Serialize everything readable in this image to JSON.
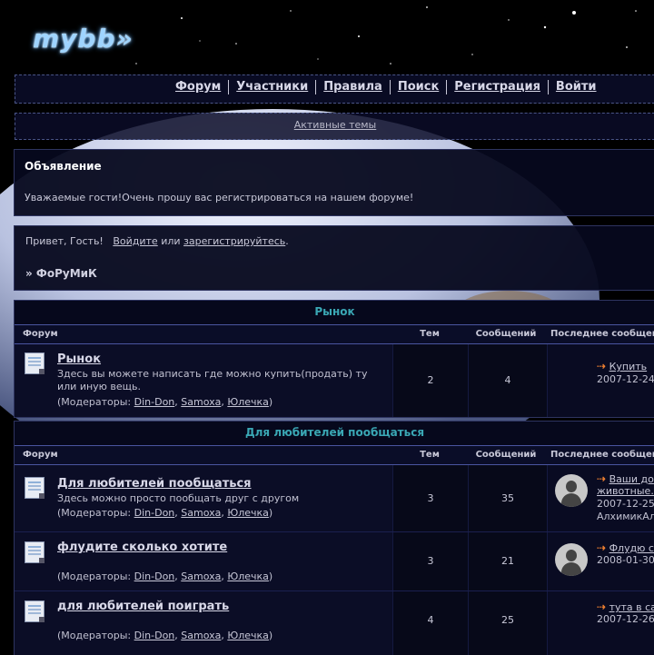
{
  "logo": "mybb»",
  "nav": {
    "items": [
      {
        "label": "Форум"
      },
      {
        "label": "Участники"
      },
      {
        "label": "Правила"
      },
      {
        "label": "Поиск"
      },
      {
        "label": "Регистрация"
      },
      {
        "label": "Войти"
      }
    ]
  },
  "subnav": {
    "active_topics": "Активные темы"
  },
  "announcement": {
    "title": "Объявление",
    "text": "Уважаемые гости!Очень прошу вас регистрироваться на нашем форуме!"
  },
  "welcome": {
    "greeting": "Привет, Гость!",
    "login": "Войдите",
    "or": "или",
    "register": "зарегистрируйтесь",
    "dot": ".",
    "breadcrumb": "» ФоРуМиК"
  },
  "table_headers": {
    "forum": "Форум",
    "topics": "Тем",
    "posts": "Сообщений",
    "last": "Последнее сообщение"
  },
  "moderators_label": "(Модераторы:",
  "moderators": [
    "Din-Don",
    "Samoxa",
    "Юлечка"
  ],
  "categories": [
    {
      "title": "Рынок",
      "forums": [
        {
          "name": "Рынок",
          "desc": "Здесь вы можете написать где можно купить(продать) ту или иную вещь.",
          "topics": "2",
          "posts": "4",
          "last_title": "Купить",
          "last_date": "2007-12-24",
          "last_user": ""
        }
      ]
    },
    {
      "title": "Для любителей пообщаться",
      "forums": [
        {
          "name": "Для любителей пообщаться",
          "desc": "Здесь можно просто пообщать друг с другом",
          "topics": "3",
          "posts": "35",
          "last_title": "Ваши до",
          "last_title2": "животные...",
          "last_date": "2007-12-25",
          "last_user": "АлхимикАл"
        },
        {
          "name": "флудите сколько хотите",
          "desc": "",
          "topics": "3",
          "posts": "21",
          "last_title": "Флудю с",
          "last_date": "2008-01-30",
          "last_user": ""
        },
        {
          "name": "для любителей поиграть",
          "desc": "",
          "topics": "4",
          "posts": "25",
          "last_title": "тута в са",
          "last_date": "2007-12-26",
          "last_user": ""
        }
      ]
    }
  ],
  "colors": {
    "category_title": "#3aa7b4",
    "arrow": "#f08030",
    "panel": "#06081c"
  }
}
